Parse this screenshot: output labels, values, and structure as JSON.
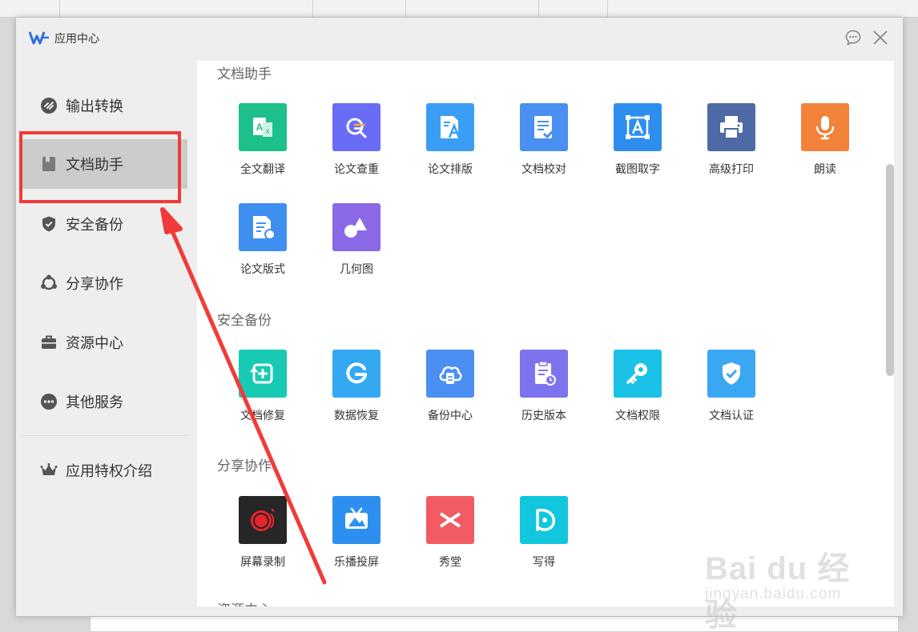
{
  "window": {
    "title": "应用中心"
  },
  "sidebar": {
    "items": [
      {
        "label": "输出转换",
        "icon": "convert-icon"
      },
      {
        "label": "文档助手",
        "icon": "document-icon",
        "active": true
      },
      {
        "label": "安全备份",
        "icon": "shield-icon"
      },
      {
        "label": "分享协作",
        "icon": "share-icon"
      },
      {
        "label": "资源中心",
        "icon": "briefcase-icon"
      },
      {
        "label": "其他服务",
        "icon": "more-icon"
      }
    ],
    "privilege": {
      "label": "应用特权介绍",
      "icon": "crown-icon"
    }
  },
  "sections": [
    {
      "title": "文档助手",
      "apps": [
        {
          "label": "全文翻译",
          "color": "#1dc08a",
          "icon": "translate-icon"
        },
        {
          "label": "论文查重",
          "color": "#6b6cf6",
          "icon": "search-doc-icon"
        },
        {
          "label": "论文排版",
          "color": "#3b9ef5",
          "icon": "typeset-icon"
        },
        {
          "label": "文档校对",
          "color": "#4a8ff2",
          "icon": "proofread-icon"
        },
        {
          "label": "截图取字",
          "color": "#2e8ef0",
          "icon": "ocr-icon"
        },
        {
          "label": "高级打印",
          "color": "#4d6aa6",
          "icon": "printer-icon"
        },
        {
          "label": "朗读",
          "color": "#f2823a",
          "icon": "microphone-icon"
        },
        {
          "label": "论文版式",
          "color": "#3f8ff0",
          "icon": "paper-format-icon"
        },
        {
          "label": "几何图",
          "color": "#8a68e6",
          "icon": "geometry-icon"
        }
      ]
    },
    {
      "title": "安全备份",
      "apps": [
        {
          "label": "文档修复",
          "color": "#18c9b3",
          "icon": "repair-icon"
        },
        {
          "label": "数据恢复",
          "color": "#35a8f2",
          "icon": "recover-icon"
        },
        {
          "label": "备份中心",
          "color": "#4c8ff2",
          "icon": "cloud-backup-icon"
        },
        {
          "label": "历史版本",
          "color": "#7e73ee",
          "icon": "history-icon"
        },
        {
          "label": "文档权限",
          "color": "#19c2e6",
          "icon": "key-icon"
        },
        {
          "label": "文档认证",
          "color": "#3aa7f3",
          "icon": "verify-shield-icon"
        }
      ]
    },
    {
      "title": "分享协作",
      "apps": [
        {
          "label": "屏幕录制",
          "color": "#262626",
          "icon": "record-icon"
        },
        {
          "label": "乐播投屏",
          "color": "#2d8ff0",
          "icon": "cast-icon"
        },
        {
          "label": "秀堂",
          "color": "#f25a64",
          "icon": "xiutang-icon"
        },
        {
          "label": "写得",
          "color": "#12c7dd",
          "icon": "xiede-icon"
        }
      ]
    },
    {
      "title": "资源中心",
      "apps": []
    }
  ],
  "watermark": {
    "line1": "Bai du 经验",
    "line2": "jingyan.baidu.com"
  }
}
